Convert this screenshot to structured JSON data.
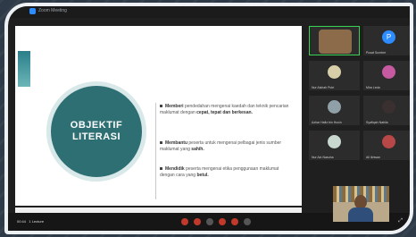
{
  "window": {
    "title": "Zoom Meeting"
  },
  "slide": {
    "circle_line1": "OBJEKTIF",
    "circle_line2": "LITERASI",
    "bullets": [
      {
        "lead": "Memberi",
        "text": "pendedahan mengenai kaedah dan teknik pencarian maklumat dengan",
        "bold_tail": "cepat, tepat dan berkesan."
      },
      {
        "lead": "Membantu",
        "text": "peserta untuk mengenai pelbagai jenis sumber maklumat yang",
        "bold_tail": "sahih."
      },
      {
        "lead": "Mendidik",
        "text": "peserta mengenai etika penggunaan maklumat dengan cara yang",
        "bold_tail": "betul."
      }
    ]
  },
  "gallery": {
    "participants": [
      {
        "name": "",
        "avatar_color": "#8c6b4a",
        "active": true
      },
      {
        "name": "Pusat Sumber",
        "avatar_color": "#2d8cff",
        "initial": "P"
      },
      {
        "name": "Nur Aishah Putri",
        "avatar_color": "#d8cfa8"
      },
      {
        "name": "Mira Leda",
        "avatar_color": "#c65aa0"
      },
      {
        "name": "Azhar Hafiz bin Husin",
        "avatar_color": "#8fa0a8"
      },
      {
        "name": "Syafiqah Nabila",
        "avatar_color": "#3a3030"
      },
      {
        "name": "Nur Ain Nasuha",
        "avatar_color": "#c9d8cf"
      },
      {
        "name": "Ali Ikhwan",
        "avatar_color": "#b84747"
      }
    ]
  },
  "toolbar": {
    "time": "00:44",
    "status": "1 Lecture",
    "view": "⤢"
  },
  "colors": {
    "accent": "#2e6f74",
    "frame": "#eef1f4",
    "background": "#2e3a47"
  }
}
